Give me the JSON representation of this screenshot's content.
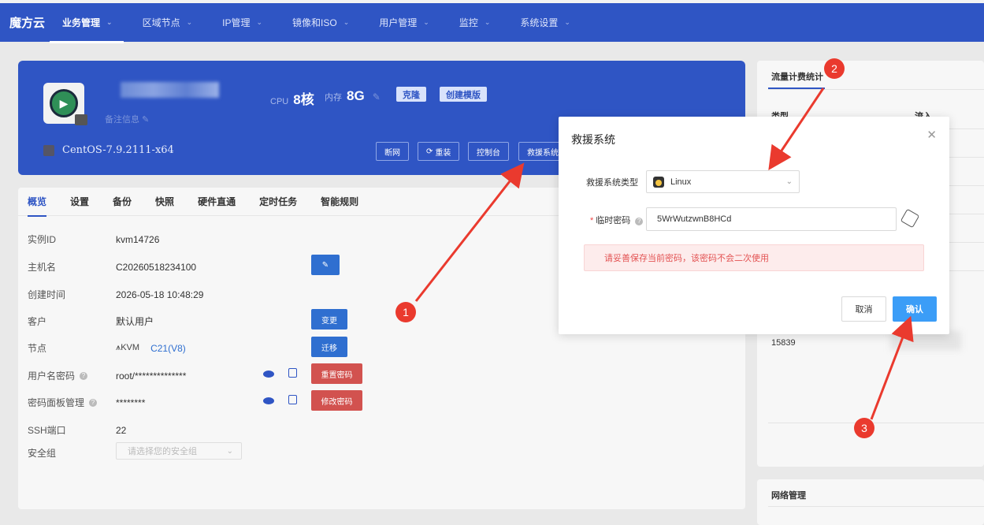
{
  "app": {
    "brand": "魔方云"
  },
  "nav": {
    "items": [
      {
        "label": "业务管理"
      },
      {
        "label": "区域节点"
      },
      {
        "label": "IP管理"
      },
      {
        "label": "镜像和ISO"
      },
      {
        "label": "用户管理"
      },
      {
        "label": "监控"
      },
      {
        "label": "系统设置"
      }
    ]
  },
  "hero": {
    "remark": "备注信息",
    "cpu_label": "CPU",
    "cpu_value": "8核",
    "mem_label": "内存",
    "mem_value": "8G",
    "clone_label": "克隆",
    "template_label": "创建模版",
    "os": "CentOS-7.9.2111-x64",
    "actions": [
      "断网",
      "重装",
      "控制台",
      "救援系统"
    ]
  },
  "tabs": [
    "概览",
    "设置",
    "备份",
    "快照",
    "硬件直通",
    "定时任务",
    "智能规则"
  ],
  "details": {
    "instance_id_label": "实例ID",
    "instance_id": "kvm14726",
    "hostname_label": "主机名",
    "hostname": "C20260518234100",
    "created_label": "创建时间",
    "created": "2026-05-18 10:48:29",
    "customer_label": "客户",
    "customer": "默认用户",
    "change_label": "变更",
    "node_label": "节点",
    "node_type": "KVM",
    "node_value": "C21(V8)",
    "migrate_label": "迁移",
    "userpass_label": "用户名密码",
    "userpass": "root/**************",
    "reset_pw_label": "重置密码",
    "panel_pw_label": "密码面板管理",
    "panel_pw": "********",
    "modify_pw_label": "修改密码",
    "ssh_label": "SSH端口",
    "ssh_port": "22",
    "secgroup_label": "安全组",
    "secgroup_placeholder": "请选择您的安全组"
  },
  "right": {
    "traffic_title": "流量计费统计",
    "col_type": "类型",
    "col_in": "流入",
    "value": "15839",
    "network_title": "网络管理"
  },
  "modal": {
    "title": "救援系统",
    "type_label": "救援系统类型",
    "type_value": "Linux",
    "password_label": "临时密码",
    "password_value": "5WrWutzwnB8HCd",
    "alert_text": "请妥善保存当前密码，该密码不会二次使用",
    "cancel_label": "取消",
    "confirm_label": "确认"
  },
  "annotations": [
    "1",
    "2",
    "3"
  ],
  "colors": {
    "primary": "#2f55c4",
    "danger": "#d2524f",
    "confirm": "#3b9df7",
    "marker": "#ea3a2e"
  }
}
